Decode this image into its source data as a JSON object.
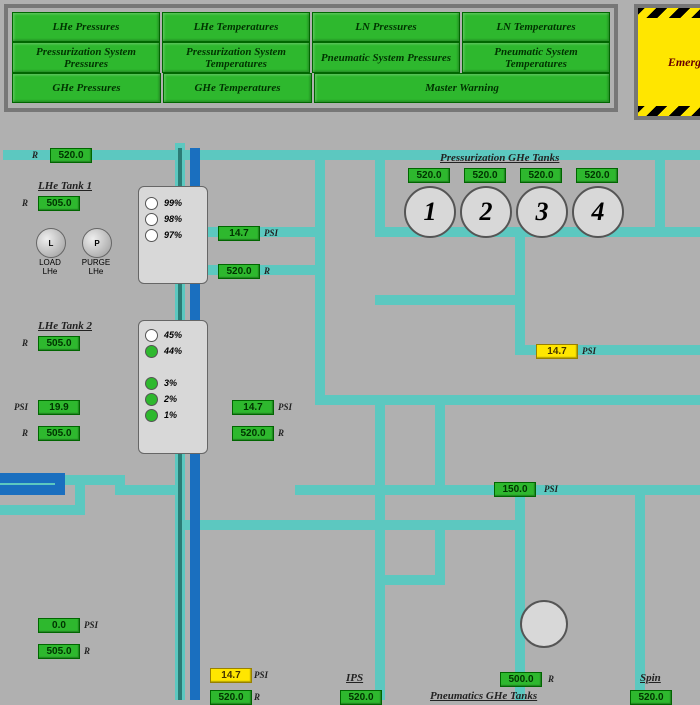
{
  "nav": {
    "r1": {
      "a": "LHe Pressures",
      "b": "LHe Temperatures",
      "c": "LN Pressures",
      "d": "LN Temperatures"
    },
    "r2": {
      "a": "Pressurization System Pressures",
      "b": "Pressurization System Temperatures",
      "c": "Pneumatic System Pressures",
      "d": "Pneumatic System Temperatures"
    },
    "r3": {
      "a": "GHe Pressures",
      "b": "GHe Temperatures",
      "c": "Master Warning"
    }
  },
  "emerg": "Emerg Pu",
  "units": {
    "R": "R",
    "PSI": "PSI"
  },
  "top": {
    "v1": "520.0"
  },
  "ghe": {
    "title": "Pressurization GHe Tanks",
    "v": [
      "520.0",
      "520.0",
      "520.0",
      "520.0"
    ],
    "n": [
      "1",
      "2",
      "3",
      "4"
    ],
    "psi": "14.7"
  },
  "lhe1": {
    "title": "LHe Tank 1",
    "R": "505.0",
    "lev": [
      "99%",
      "98%",
      "97%"
    ],
    "psi": "14.7",
    "temp": "520.0"
  },
  "lhe2": {
    "title": "LHe Tank 2",
    "R": "505.0",
    "lev": [
      "45%",
      "44%"
    ],
    "lev2": [
      "3%",
      "2%",
      "1%"
    ],
    "psi": "14.7",
    "temp": "520.0"
  },
  "btns": {
    "load": "L",
    "loadlbl": "LOAD",
    "loadsub": "LHe",
    "purge": "P",
    "purgelbl": "PURGE",
    "purgesub": "LHe"
  },
  "left": {
    "psi": "19.9",
    "R": "505.0"
  },
  "bl": {
    "psi": "0.0",
    "R": "505.0"
  },
  "mid": {
    "psi": "150.0"
  },
  "bot": {
    "psi": "14.7",
    "R": "520.0",
    "ips": "IPS",
    "ipsv": "520.0",
    "pneu": "Pneumatics GHe Tanks",
    "pv": "500.0",
    "spin": "Spin",
    "spinv": "520.0"
  }
}
